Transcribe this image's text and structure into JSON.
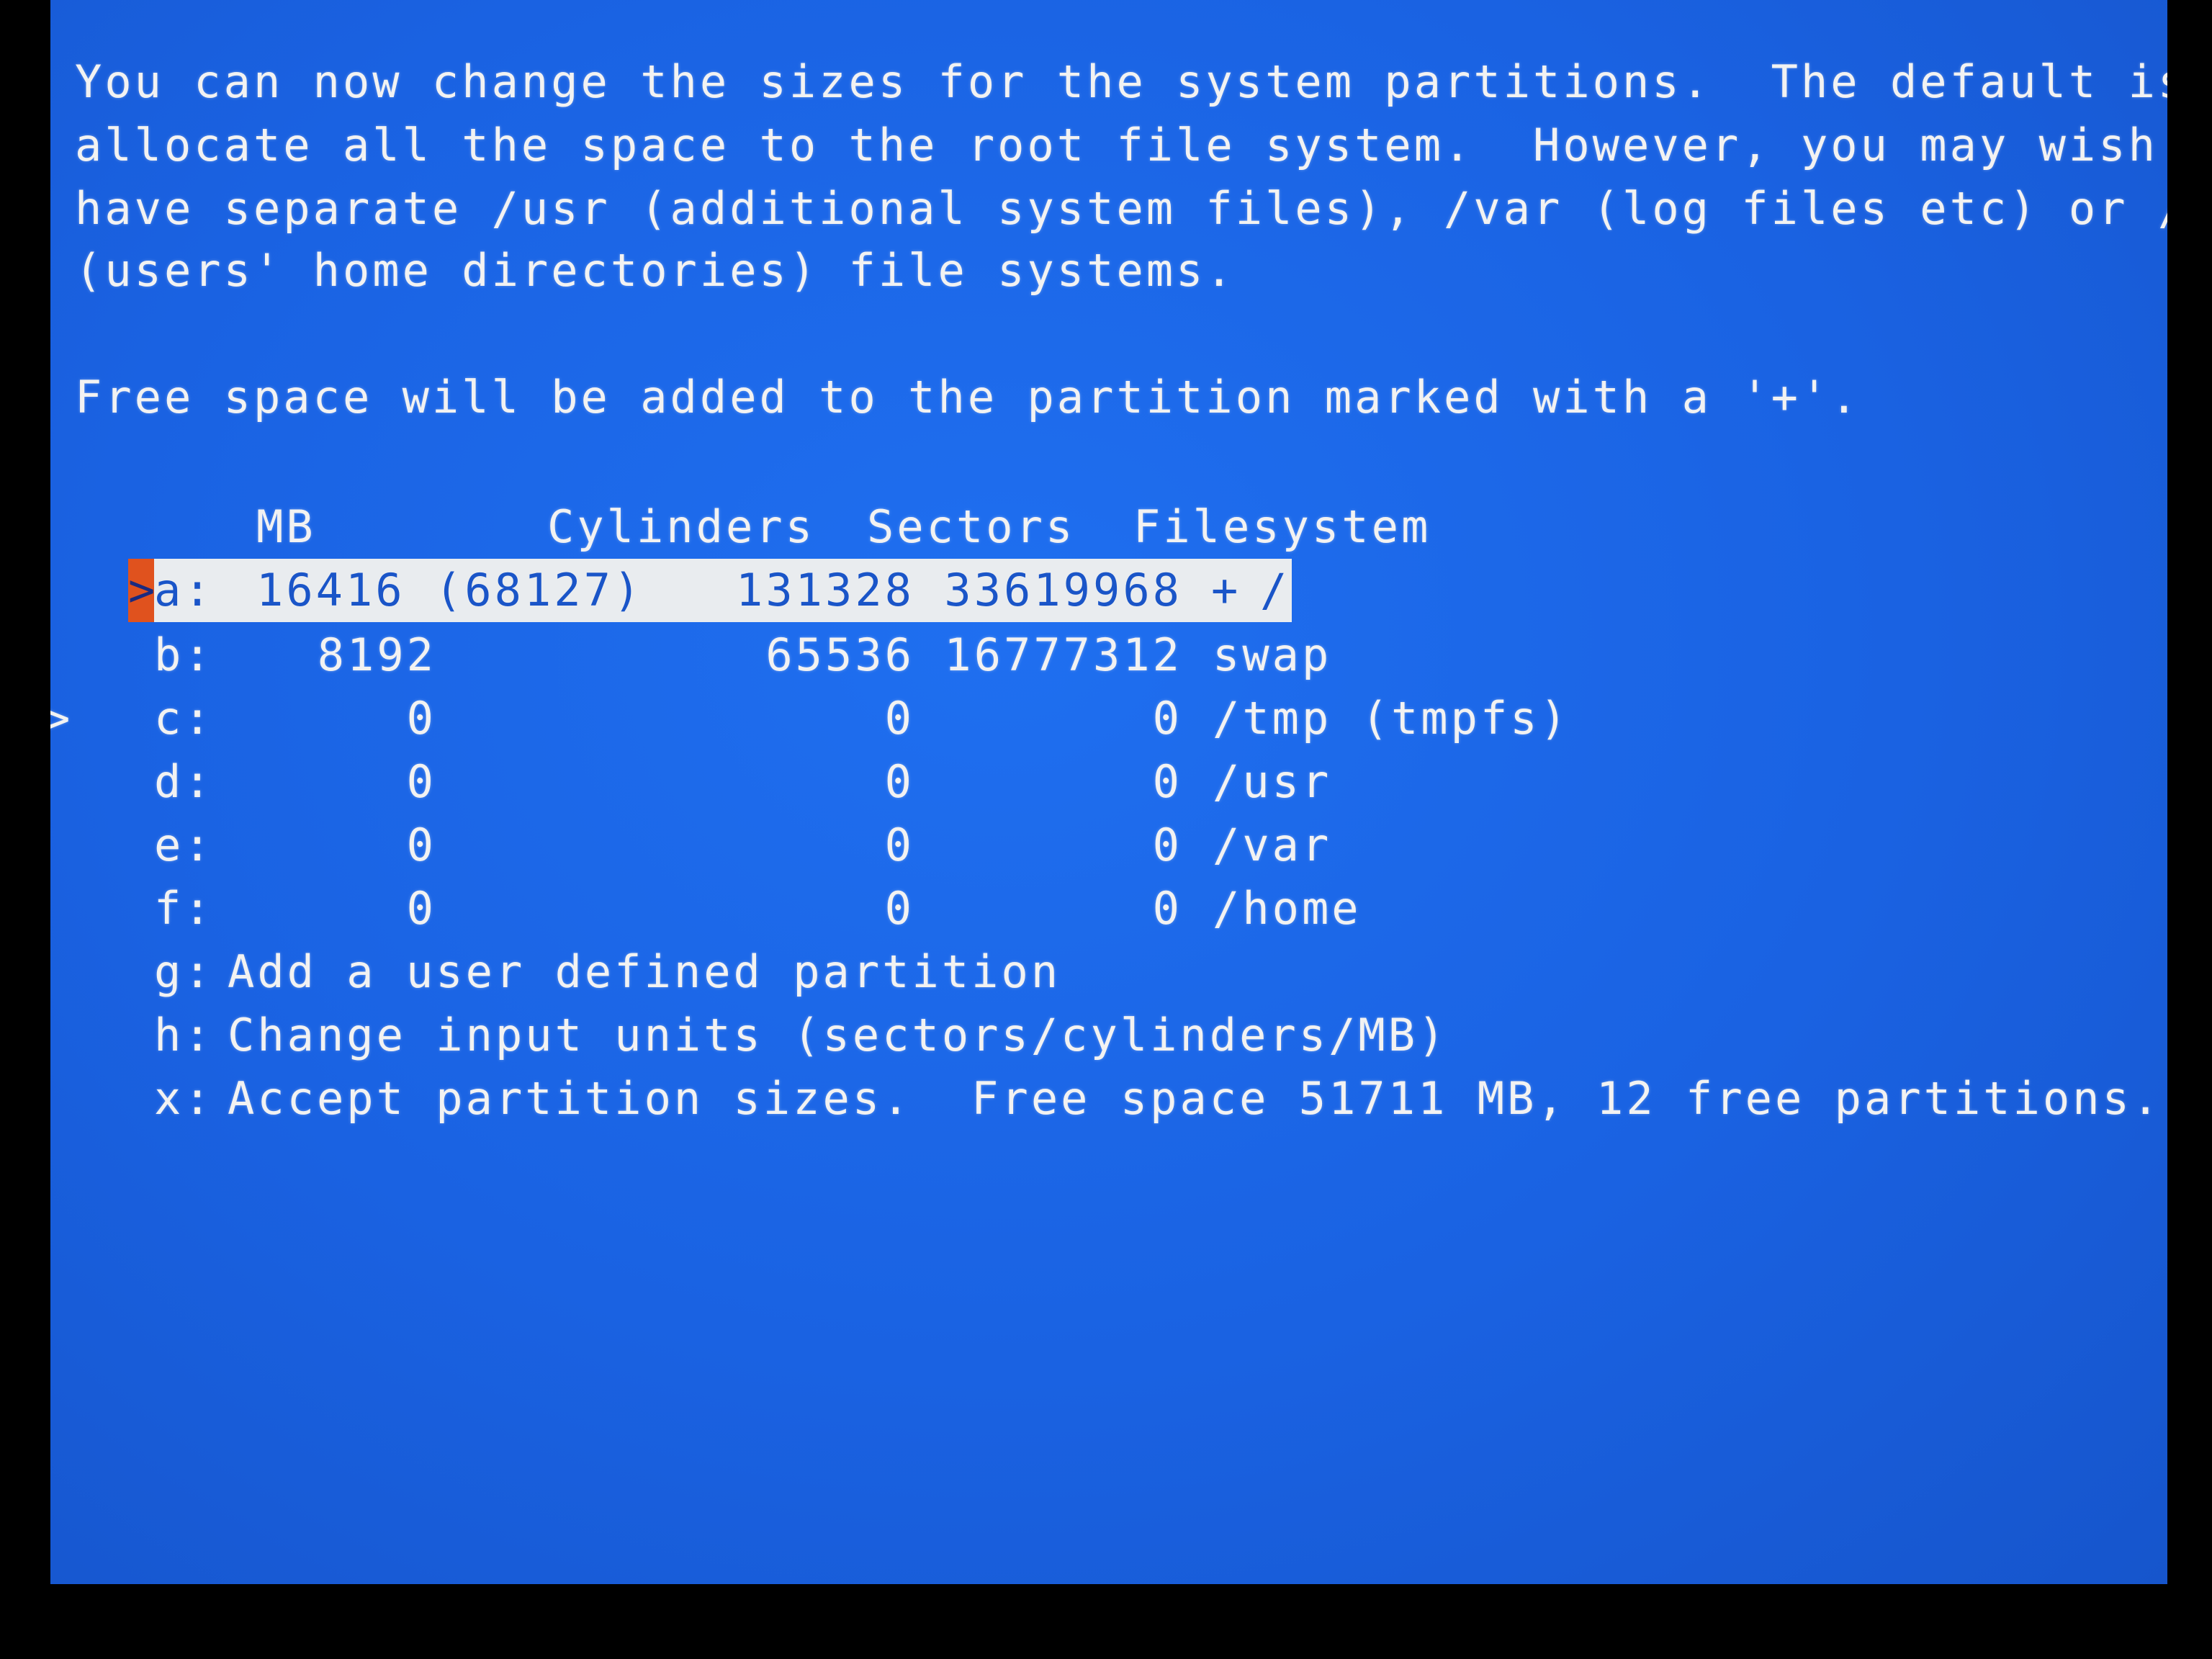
{
  "intro": {
    "line1": "You can now change the sizes for the system partitions.  The default is to",
    "line2": "allocate all the space to the root file system.  However, you may wish to",
    "line3": "have separate /usr (additional system files), /var (log files etc) or /home",
    "line4": "(users' home directories) file systems.",
    "line5": "Free space will be added to the partition marked with a '+'."
  },
  "table": {
    "headers": {
      "mb": "MB",
      "cylinders": "Cylinders",
      "sectors": "Sectors",
      "filesystem": "Filesystem"
    },
    "rows": [
      {
        "key": "a:",
        "mb": "16416 (68127)",
        "cylinders": "131328",
        "sectors": "33619968",
        "flag": "+",
        "fs": "/"
      },
      {
        "key": "b:",
        "mb": "8192",
        "cylinders": "65536",
        "sectors": "16777312",
        "flag": "",
        "fs": "swap"
      },
      {
        "key": "c:",
        "mb": "0",
        "cylinders": "0",
        "sectors": "0",
        "flag": "",
        "fs": "/tmp (tmpfs)"
      },
      {
        "key": "d:",
        "mb": "0",
        "cylinders": "0",
        "sectors": "0",
        "flag": "",
        "fs": "/usr"
      },
      {
        "key": "e:",
        "mb": "0",
        "cylinders": "0",
        "sectors": "0",
        "flag": "",
        "fs": "/var"
      },
      {
        "key": "f:",
        "mb": "0",
        "cylinders": "0",
        "sectors": "0",
        "flag": "",
        "fs": "/home"
      }
    ]
  },
  "options": [
    {
      "key": "g:",
      "label": "Add a user defined partition"
    },
    {
      "key": "h:",
      "label": "Change input units (sectors/cylinders/MB)"
    },
    {
      "key": "x:",
      "label": "Accept partition sizes.  Free space 51711 MB, 12 free partitions."
    }
  ],
  "selected_marker": ">",
  "side_marker": ">",
  "colors": {
    "background": "#1a62e2",
    "text": "#f2f2f2",
    "highlight": "#e9ecef",
    "highlight_text": "#1a55c8",
    "cursor": "#e0521e"
  }
}
